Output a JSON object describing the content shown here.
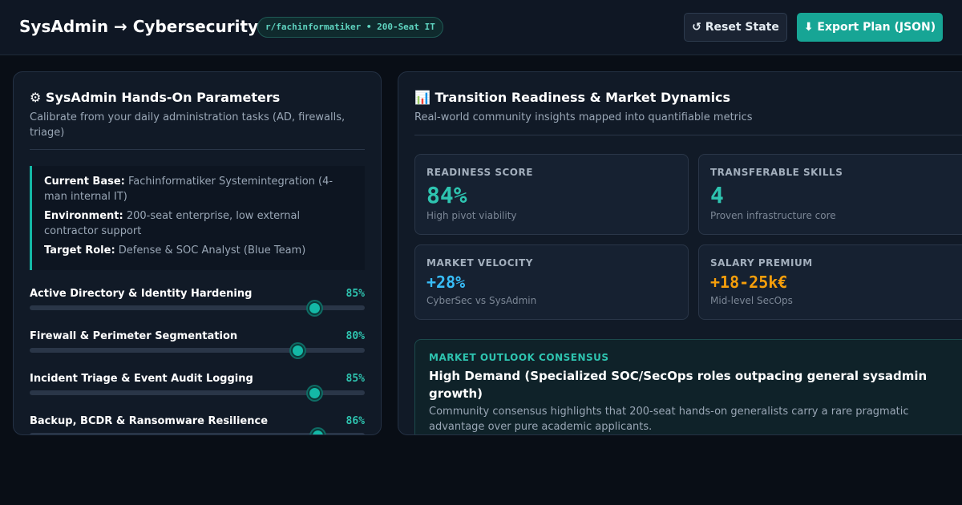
{
  "header": {
    "title": "SysAdmin → Cybersecurity",
    "badge": "r/fachinformatiker • 200-Seat IT",
    "reset_label": "↺ Reset State",
    "export_label": "⬇ Export Plan (JSON)"
  },
  "left_panel": {
    "title": "⚙ SysAdmin Hands-On Parameters",
    "subtitle": "Calibrate from your daily administration tasks (AD, firewalls, triage)",
    "profile": {
      "base_label": "Current Base:",
      "base_value": "Fachinformatiker Systemintegration (4-man internal IT)",
      "env_label": "Environment:",
      "env_value": "200-seat enterprise, low external contractor support",
      "target_label": "Target Role:",
      "target_value": "Defense & SOC Analyst (Blue Team)"
    },
    "parameters": [
      {
        "label": "Active Directory & Identity Hardening",
        "value_text": "85%",
        "value": 85
      },
      {
        "label": "Firewall & Perimeter Segmentation",
        "value_text": "80%",
        "value": 80
      },
      {
        "label": "Incident Triage & Event Audit Logging",
        "value_text": "85%",
        "value": 85
      },
      {
        "label": "Backup, BCDR & Ransomware Resilience",
        "value_text": "86%",
        "value": 86
      }
    ]
  },
  "right_panel": {
    "title": "📊 Transition Readiness & Market Dynamics",
    "subtitle": "Real-world community insights mapped into quantifiable metrics",
    "metrics": [
      {
        "label": "READINESS SCORE",
        "value": "84%",
        "note": "High pivot viability",
        "color": "#2ec4b0"
      },
      {
        "label": "TRANSFERABLE SKILLS",
        "value": "4",
        "note": "Proven infrastructure core",
        "color": "#2ec4b0"
      },
      {
        "label": "MARKET VELOCITY",
        "value": "+28%",
        "note": "CyberSec vs SysAdmin",
        "color": "#38bdf8"
      },
      {
        "label": "SALARY PREMIUM",
        "value": "+18-25k€",
        "note": "Mid-level SecOps",
        "color": "#f59e0b"
      }
    ],
    "outlook": {
      "label": "MARKET OUTLOOK CONSENSUS",
      "title": "High Demand (Specialized SOC/SecOps roles outpacing general sysadmin growth)",
      "text": "Community consensus highlights that 200-seat hands-on generalists carry a rare pragmatic advantage over pure academic applicants."
    }
  }
}
